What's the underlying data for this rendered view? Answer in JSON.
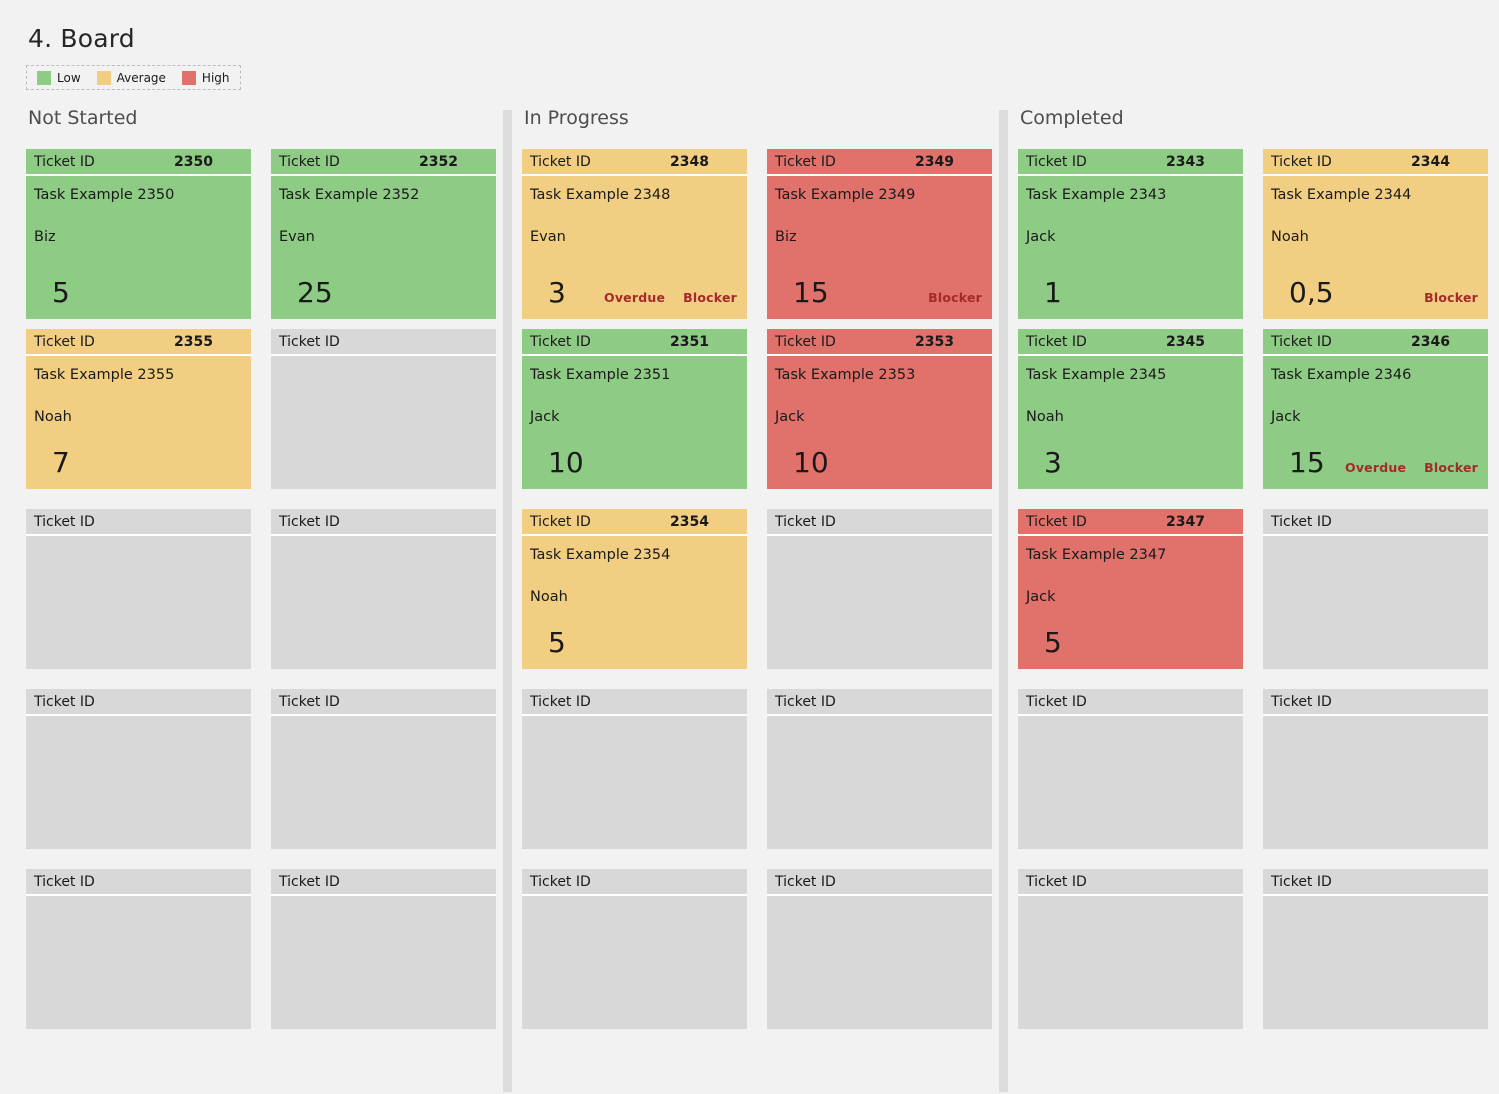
{
  "page_title": "4. Board",
  "legend": {
    "items": [
      {
        "label": "Low",
        "color": "#8ecb84"
      },
      {
        "label": "Average",
        "color": "#f2ce82"
      },
      {
        "label": "High",
        "color": "#e0716b"
      }
    ]
  },
  "card_labels": {
    "ticket_id": "Ticket ID",
    "overdue": "Overdue",
    "blocker": "Blocker"
  },
  "colors": {
    "low": "#8ecb84",
    "average": "#f2ce82",
    "high": "#e0716b",
    "empty": "#d8d8d8",
    "flag_text": "#a52a2a",
    "background": "#f2f2f2",
    "divider": "#dcdcdc"
  },
  "columns": [
    {
      "title": "Not Started",
      "cards": [
        {
          "ticket_id": "2350",
          "task": "Task Example 2350",
          "owner": "Biz",
          "value": "5",
          "priority": "low",
          "overdue": false,
          "blocker": false
        },
        {
          "ticket_id": "2352",
          "task": "Task Example 2352",
          "owner": "Evan",
          "value": "25",
          "priority": "low",
          "overdue": false,
          "blocker": false
        },
        {
          "ticket_id": "2355",
          "task": "Task Example 2355",
          "owner": "Noah",
          "value": "7",
          "priority": "average",
          "overdue": false,
          "blocker": false
        },
        {
          "ticket_id": "",
          "task": "",
          "owner": "",
          "value": "",
          "priority": "empty",
          "overdue": false,
          "blocker": false
        },
        {
          "ticket_id": "",
          "task": "",
          "owner": "",
          "value": "",
          "priority": "empty",
          "overdue": false,
          "blocker": false
        },
        {
          "ticket_id": "",
          "task": "",
          "owner": "",
          "value": "",
          "priority": "empty",
          "overdue": false,
          "blocker": false
        },
        {
          "ticket_id": "",
          "task": "",
          "owner": "",
          "value": "",
          "priority": "empty",
          "overdue": false,
          "blocker": false
        },
        {
          "ticket_id": "",
          "task": "",
          "owner": "",
          "value": "",
          "priority": "empty",
          "overdue": false,
          "blocker": false
        },
        {
          "ticket_id": "",
          "task": "",
          "owner": "",
          "value": "",
          "priority": "empty",
          "overdue": false,
          "blocker": false
        },
        {
          "ticket_id": "",
          "task": "",
          "owner": "",
          "value": "",
          "priority": "empty",
          "overdue": false,
          "blocker": false
        }
      ]
    },
    {
      "title": "In Progress",
      "cards": [
        {
          "ticket_id": "2348",
          "task": "Task Example 2348",
          "owner": "Evan",
          "value": "3",
          "priority": "average",
          "overdue": true,
          "blocker": true
        },
        {
          "ticket_id": "2349",
          "task": "Task Example 2349",
          "owner": "Biz",
          "value": "15",
          "priority": "high",
          "overdue": false,
          "blocker": true
        },
        {
          "ticket_id": "2351",
          "task": "Task Example 2351",
          "owner": "Jack",
          "value": "10",
          "priority": "low",
          "overdue": false,
          "blocker": false
        },
        {
          "ticket_id": "2353",
          "task": "Task Example 2353",
          "owner": "Jack",
          "value": "10",
          "priority": "high",
          "overdue": false,
          "blocker": false
        },
        {
          "ticket_id": "2354",
          "task": "Task Example 2354",
          "owner": "Noah",
          "value": "5",
          "priority": "average",
          "overdue": false,
          "blocker": false
        },
        {
          "ticket_id": "",
          "task": "",
          "owner": "",
          "value": "",
          "priority": "empty",
          "overdue": false,
          "blocker": false
        },
        {
          "ticket_id": "",
          "task": "",
          "owner": "",
          "value": "",
          "priority": "empty",
          "overdue": false,
          "blocker": false
        },
        {
          "ticket_id": "",
          "task": "",
          "owner": "",
          "value": "",
          "priority": "empty",
          "overdue": false,
          "blocker": false
        },
        {
          "ticket_id": "",
          "task": "",
          "owner": "",
          "value": "",
          "priority": "empty",
          "overdue": false,
          "blocker": false
        },
        {
          "ticket_id": "",
          "task": "",
          "owner": "",
          "value": "",
          "priority": "empty",
          "overdue": false,
          "blocker": false
        }
      ]
    },
    {
      "title": "Completed",
      "cards": [
        {
          "ticket_id": "2343",
          "task": "Task Example 2343",
          "owner": "Jack",
          "value": "1",
          "priority": "low",
          "overdue": false,
          "blocker": false
        },
        {
          "ticket_id": "2344",
          "task": "Task Example 2344",
          "owner": "Noah",
          "value": "0,5",
          "priority": "average",
          "overdue": false,
          "blocker": true
        },
        {
          "ticket_id": "2345",
          "task": "Task Example 2345",
          "owner": "Noah",
          "value": "3",
          "priority": "low",
          "overdue": false,
          "blocker": false
        },
        {
          "ticket_id": "2346",
          "task": "Task Example 2346",
          "owner": "Jack",
          "value": "15",
          "priority": "low",
          "overdue": true,
          "blocker": true
        },
        {
          "ticket_id": "2347",
          "task": "Task Example 2347",
          "owner": "Jack",
          "value": "5",
          "priority": "high",
          "overdue": false,
          "blocker": false
        },
        {
          "ticket_id": "",
          "task": "",
          "owner": "",
          "value": "",
          "priority": "empty",
          "overdue": false,
          "blocker": false
        },
        {
          "ticket_id": "",
          "task": "",
          "owner": "",
          "value": "",
          "priority": "empty",
          "overdue": false,
          "blocker": false
        },
        {
          "ticket_id": "",
          "task": "",
          "owner": "",
          "value": "",
          "priority": "empty",
          "overdue": false,
          "blocker": false
        },
        {
          "ticket_id": "",
          "task": "",
          "owner": "",
          "value": "",
          "priority": "empty",
          "overdue": false,
          "blocker": false
        },
        {
          "ticket_id": "",
          "task": "",
          "owner": "",
          "value": "",
          "priority": "empty",
          "overdue": false,
          "blocker": false
        }
      ]
    }
  ]
}
